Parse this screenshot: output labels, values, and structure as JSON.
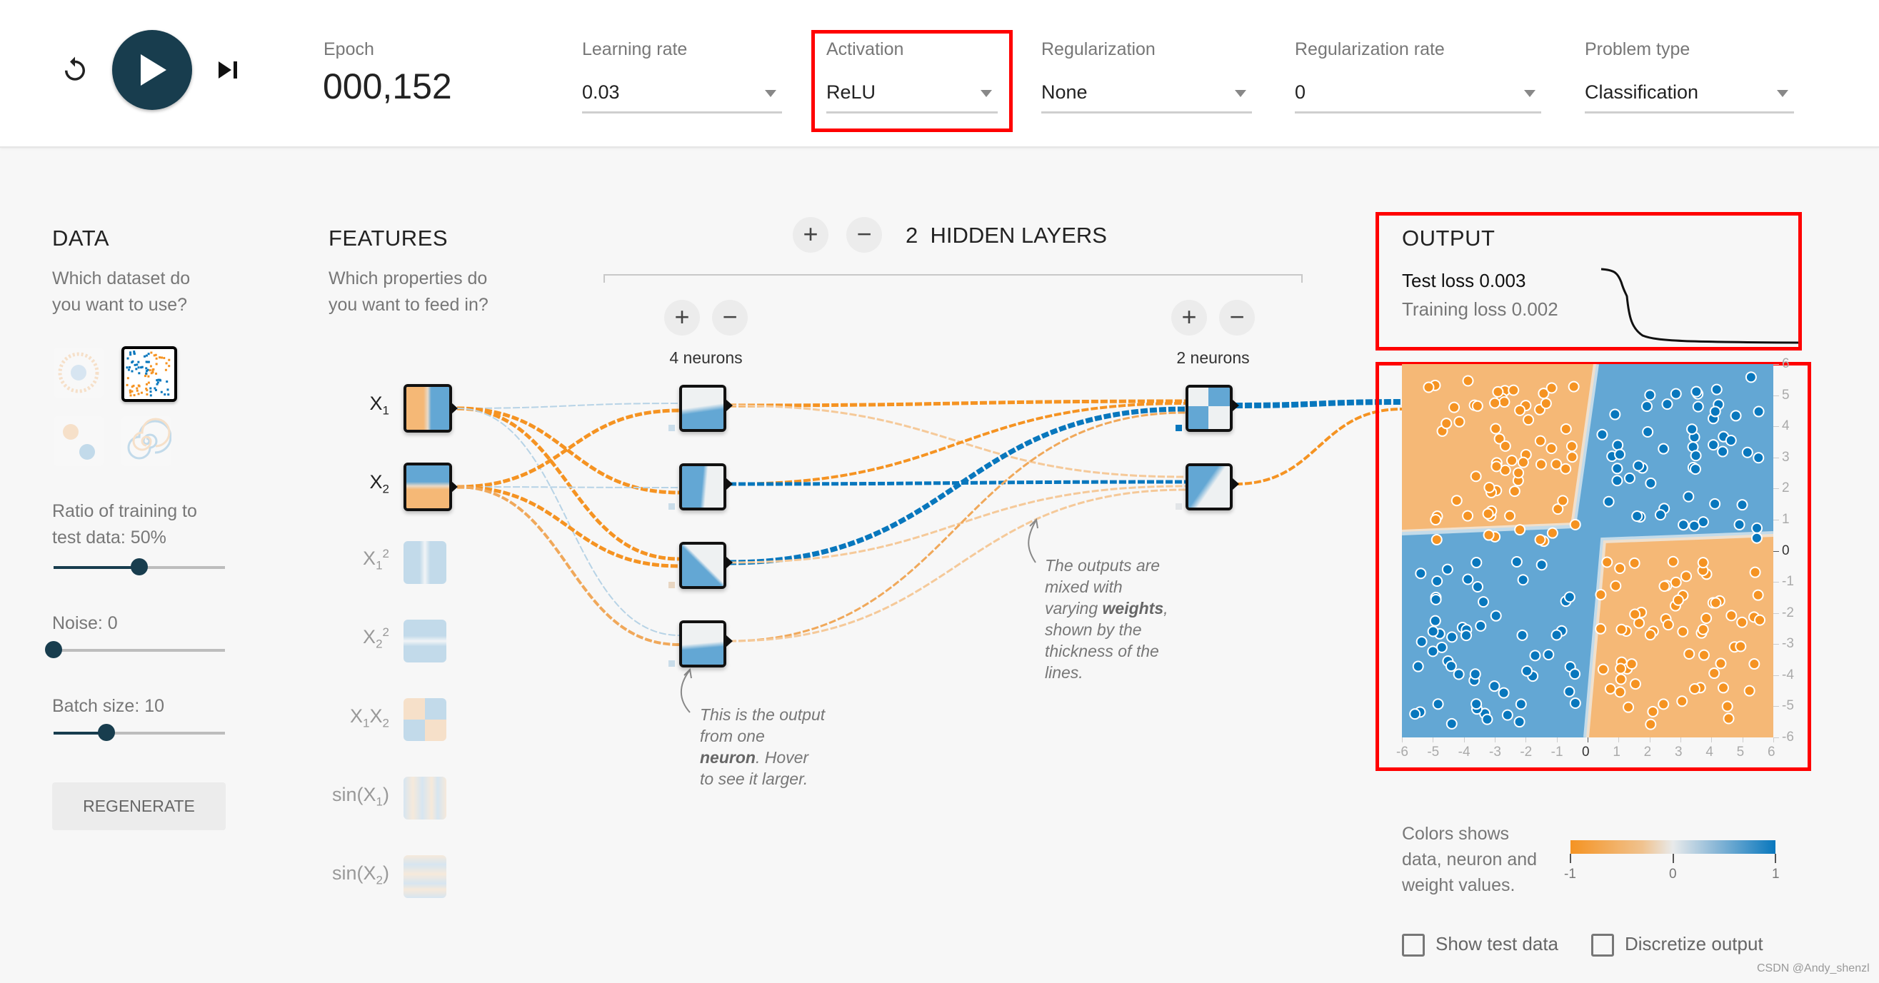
{
  "header": {
    "reset_icon": "reset-icon",
    "play_icon": "play-icon",
    "step_icon": "step-forward-icon",
    "epoch_label": "Epoch",
    "epoch_value": "000,152",
    "controls": [
      {
        "label": "Learning rate",
        "value": "0.03"
      },
      {
        "label": "Activation",
        "value": "ReLU"
      },
      {
        "label": "Regularization",
        "value": "None"
      },
      {
        "label": "Regularization rate",
        "value": "0"
      },
      {
        "label": "Problem type",
        "value": "Classification"
      }
    ]
  },
  "data_panel": {
    "title": "DATA",
    "subtitle_line1": "Which dataset do",
    "subtitle_line2": "you want to use?",
    "datasets": [
      {
        "name": "circle",
        "selected": false
      },
      {
        "name": "xor",
        "selected": true
      },
      {
        "name": "gaussian",
        "selected": false
      },
      {
        "name": "spiral",
        "selected": false
      }
    ],
    "ratio_label_line1": "Ratio of training to",
    "ratio_label_line2": "test data:  50%",
    "ratio_value": 0.5,
    "noise_label": "Noise:  0",
    "noise_value": 0,
    "batch_label": "Batch size:  10",
    "batch_value": 0.31,
    "regenerate_label": "REGENERATE"
  },
  "features_panel": {
    "title": "FEATURES",
    "subtitle_line1": "Which properties do",
    "subtitle_line2": "you want to feed in?",
    "features": [
      {
        "base": "X",
        "sub": "1",
        "sup": "",
        "active": true
      },
      {
        "base": "X",
        "sub": "2",
        "sup": "",
        "active": true
      },
      {
        "base": "X",
        "sub": "1",
        "sup": "2",
        "active": false
      },
      {
        "base": "X",
        "sub": "2",
        "sup": "2",
        "active": false
      },
      {
        "base": "X",
        "sub": "1",
        "tail": "X",
        "sub2": "2",
        "active": false
      },
      {
        "base": "sin(X",
        "sub": "1",
        "close": ")",
        "active": false
      },
      {
        "base": "sin(X",
        "sub": "2",
        "close": ")",
        "active": false
      }
    ]
  },
  "network": {
    "hidden_layers_count": "2",
    "hidden_layers_label": "HIDDEN LAYERS",
    "add_layer": "+",
    "remove_layer": "−",
    "layers": [
      {
        "neurons_label": "4 neurons",
        "add": "+",
        "remove": "−"
      },
      {
        "neurons_label": "2 neurons",
        "add": "+",
        "remove": "−"
      }
    ],
    "annotation_neuron": {
      "line1": "This is the output",
      "line2": "from one",
      "bold": "neuron",
      "line3_rest": ". Hover",
      "line4": "to see it larger."
    },
    "annotation_weights": {
      "line1": "The outputs are",
      "line2": "mixed with",
      "line3_pre": "varying ",
      "bold": "weights",
      "line3_post": ",",
      "line4": "shown by the",
      "line5": "thickness of the",
      "line6": "lines."
    }
  },
  "output_panel": {
    "title": "OUTPUT",
    "test_loss": "Test loss 0.003",
    "training_loss": "Training loss 0.002",
    "x_ticks": [
      "-6",
      "-5",
      "-4",
      "-3",
      "-2",
      "-1",
      "0",
      "1",
      "2",
      "3",
      "4",
      "5",
      "6"
    ],
    "y_ticks": [
      "6",
      "5",
      "4",
      "3",
      "2",
      "1",
      "0",
      "-1",
      "-2",
      "-3",
      "-4",
      "-5",
      "-6"
    ],
    "legend_line1": "Colors shows",
    "legend_line2": "data, neuron and",
    "legend_line3": "weight values.",
    "legend_ticks": [
      "-1",
      "0",
      "1"
    ],
    "show_test_data_label": "Show test data",
    "show_test_data_checked": false,
    "discretize_label": "Discretize output",
    "discretize_checked": false
  },
  "colors": {
    "orange": "#f59322",
    "blue": "#0877bd",
    "light_orange": "#f5b876",
    "light_blue": "#63a7d4",
    "dark_navy": "#183d4e",
    "highlight_red": "#ff0000"
  },
  "watermark": "CSDN @Andy_shenzl"
}
